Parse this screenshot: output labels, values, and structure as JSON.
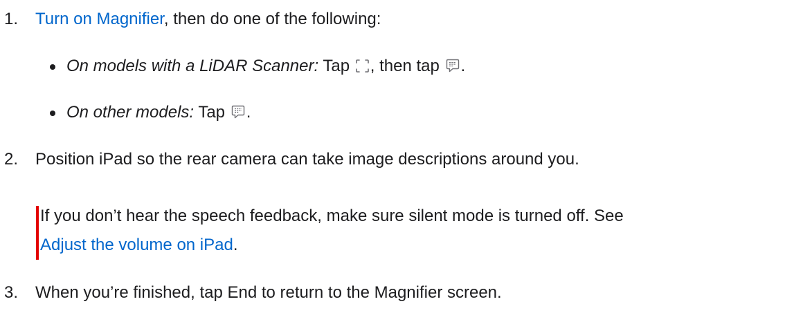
{
  "steps": [
    {
      "number": "1.",
      "link_text": "Turn on Magnifier",
      "text_after": ", then do one of the following:",
      "bullets": [
        {
          "label": "On models with a LiDAR Scanner:",
          "text_a": " Tap ",
          "icon_a": "detection-mode-icon",
          "text_b": ", then tap ",
          "icon_b": "image-descriptions-icon",
          "text_c": "."
        },
        {
          "label": "On other models:",
          "text_a": " Tap ",
          "icon_a": "image-descriptions-icon",
          "text_c": "."
        }
      ]
    },
    {
      "number": "2.",
      "text": "Position iPad so the rear camera can take image descriptions around you."
    },
    {
      "number": "3.",
      "text": "When you’re finished, tap End to return to the Magnifier screen."
    }
  ],
  "note": {
    "text": "If you don’t hear the speech feedback, make sure silent mode is turned off. See",
    "link_text": "Adjust the volume on iPad",
    "text_after": ".",
    "accent_color": "#e30000"
  },
  "colors": {
    "text": "#1d1d1f",
    "link": "#0066cc",
    "icon": "#6e6e73"
  }
}
